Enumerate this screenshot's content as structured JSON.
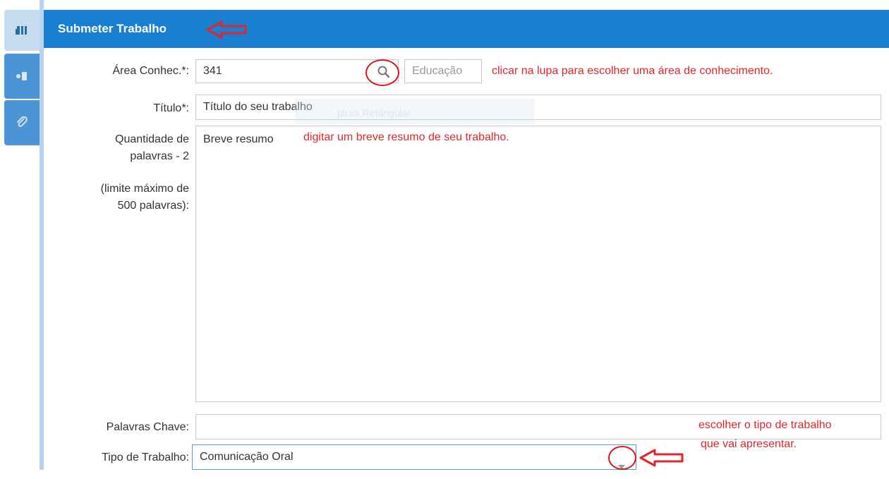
{
  "rail": {
    "tabs": [
      {
        "icon": "form-icon",
        "active": true
      },
      {
        "icon": "users-icon",
        "active": false
      },
      {
        "icon": "paperclip-icon",
        "active": false
      }
    ]
  },
  "header": {
    "title": "Submeter Trabalho",
    "color": "#1a7fd0"
  },
  "form": {
    "area": {
      "label": "Área Conhec.*:",
      "value": "341",
      "search_icon": "search-icon",
      "description": "Educação"
    },
    "titulo": {
      "label": "Título*:",
      "value": "Título do seu trabalho"
    },
    "resumo": {
      "label_line1": "Quantidade de",
      "label_line2": "palavras - 2",
      "label_line3": "(limite máximo de",
      "label_line4": "500 palavras):",
      "value": "Breve resumo"
    },
    "palavras_chave": {
      "label": "Palavras Chave:",
      "value": ""
    },
    "tipo": {
      "label": "Tipo de Trabalho:",
      "selected": "Comunicação Oral",
      "dropdown_icon": "chevron-down-icon"
    }
  },
  "annotations": {
    "area_hint": "clicar na lupa para escolher uma área de conhecimento.",
    "resumo_hint": "digitar um breve resumo de seu trabalho.",
    "tipo_hint_line1": "escolher o tipo de trabalho",
    "tipo_hint_line2": "que vai apresentar.",
    "color": "#e0262b"
  },
  "overlay": {
    "ghost_text": "ptura Retangular"
  }
}
